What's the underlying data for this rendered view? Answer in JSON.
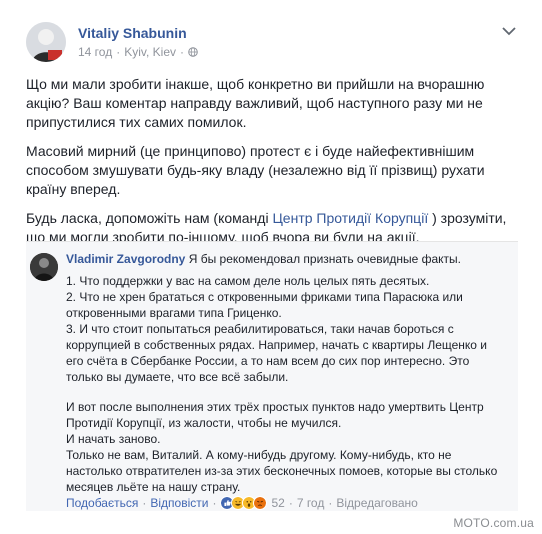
{
  "post": {
    "author": "Vitaliy Shabunin",
    "time": "14 год",
    "location": "Kyiv, Kiev",
    "paragraphs": [
      "Що ми мали зробити інакше, щоб конкретно ви прийшли на вчорашню акцію? Ваш коментар направду важливий, щоб наступного разу ми не припустилися тих самих помилок.",
      "Масовий мирний (це принципово) протест є і буде найефективнішим способом змушувати будь-яку владу (незалежно від її прізвищ) рухати країну вперед."
    ],
    "p3_before": "Будь ласка, допоможіть нам (команді ",
    "p3_link": "Центр Протидії Корупції",
    "p3_after": " ) зрозуміти, що ми могли зробити по-іншому, щоб вчора ви були на акції."
  },
  "comment": {
    "author": "Vladimir Zavgorodny",
    "intro": "Я бы рекомендовал признать очевидные факты.",
    "points": [
      "1. Что поддержки у вас на самом деле ноль целых пять десятых.",
      "2. Что не хрен брататься с откровенными фриками типа Парасюка или откровенными врагами типа Гриценко.",
      "3. И что стоит попытаться реабилитироваться, таки начав бороться с коррупцией в собственных рядах. Например, начать с квартиры Лещенко и его счёта в Сбербанке России, а то нам всем до сих пор интересно. Это только вы думаете, что все всё забыли."
    ],
    "closing": [
      "И вот после выполнения этих трёх простых пунктов надо умертвить Центр Протидії Корупції, из жалости, чтобы не мучился.",
      "И начать заново.",
      "Только не вам, Виталий. А кому-нибудь другому. Кому-нибудь, кто не настолько отвратителен из-за этих бесконечных помоев, которые вы столько месяцев льёте на нашу страну."
    ],
    "like": "Подобається",
    "reply": "Відповісти",
    "reactions_count": "52",
    "time": "7 год",
    "edited": "Відредаговано"
  },
  "watermark": "MOTO.com.ua",
  "colors": {
    "link": "#365899",
    "action": "#4267b2",
    "muted": "#90949c",
    "comment_bg": "#f6f7f9"
  }
}
